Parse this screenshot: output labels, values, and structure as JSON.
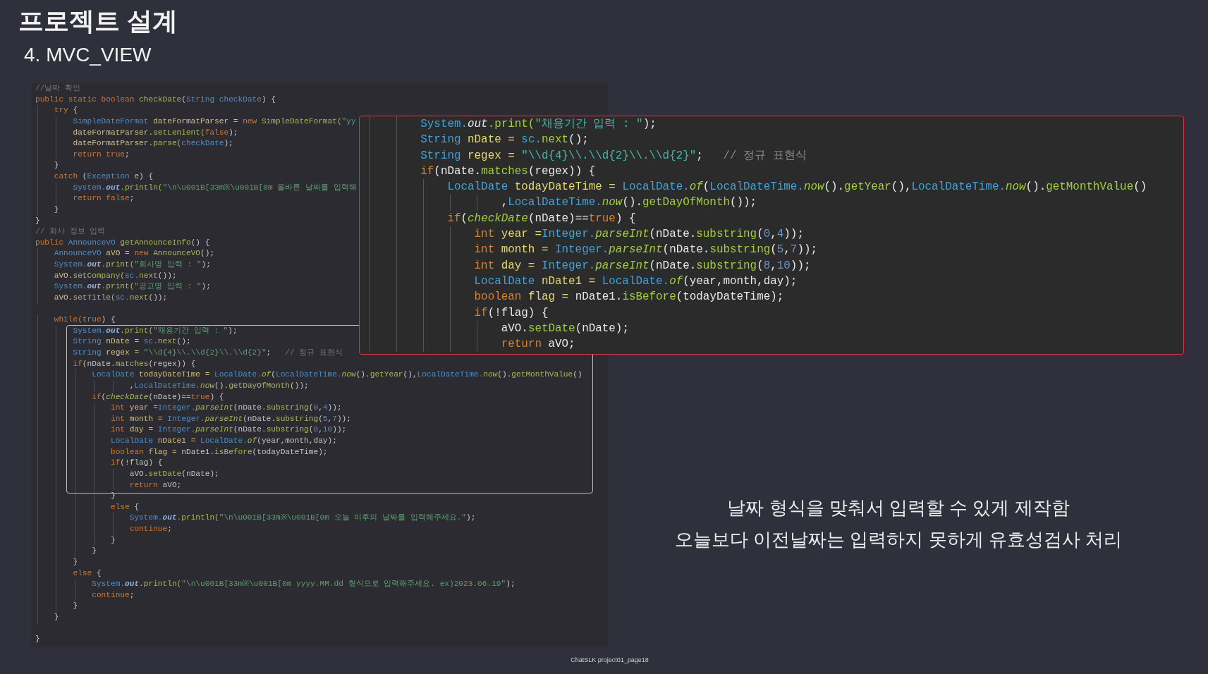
{
  "slide": {
    "title": "프로젝트 설계",
    "subtitle": "4. MVC_VIEW"
  },
  "code_panel": {
    "lines": [
      {
        "kind": "code",
        "tokens": [
          {
            "text": "//날짜 확인",
            "kind": "c"
          }
        ]
      },
      {
        "kind": "code",
        "tokens": [
          {
            "text": "public static boolean ",
            "kind": "k"
          },
          {
            "text": "checkDate",
            "kind": "m"
          },
          {
            "text": "(",
            "kind": "p"
          },
          {
            "text": "String ",
            "kind": "t"
          },
          {
            "text": "checkDate",
            "kind": "t"
          },
          {
            "text": ") {",
            "kind": "p"
          }
        ]
      },
      {
        "kind": "code",
        "tokens": [
          {
            "text": "    try ",
            "kind": "k"
          },
          {
            "text": "{",
            "kind": "p"
          }
        ]
      },
      {
        "kind": "code",
        "tokens": [
          {
            "text": "        SimpleDateFormat ",
            "kind": "t"
          },
          {
            "text": "dateFormatParser = ",
            "kind": "v"
          },
          {
            "text": "new ",
            "kind": "k"
          },
          {
            "text": "SimpleDateFormat(",
            "kind": "m"
          },
          {
            "text": "\"yy",
            "kind": "s"
          }
        ]
      },
      {
        "kind": "code",
        "tokens": [
          {
            "text": "        dateFormatParser.",
            "kind": "v"
          },
          {
            "text": "setLenient(",
            "kind": "m"
          },
          {
            "text": "false",
            "kind": "k"
          },
          {
            "text": ");",
            "kind": "p"
          }
        ]
      },
      {
        "kind": "code",
        "tokens": [
          {
            "text": "        dateFormatParser.",
            "kind": "v"
          },
          {
            "text": "parse(",
            "kind": "m"
          },
          {
            "text": "checkDate",
            "kind": "t"
          },
          {
            "text": ");",
            "kind": "p"
          }
        ]
      },
      {
        "kind": "code",
        "tokens": [
          {
            "text": "        return true",
            "kind": "k"
          },
          {
            "text": ";",
            "kind": "p"
          }
        ]
      },
      {
        "kind": "code",
        "tokens": [
          {
            "text": "    }",
            "kind": "p"
          }
        ]
      },
      {
        "kind": "code",
        "tokens": [
          {
            "text": "    catch ",
            "kind": "k"
          },
          {
            "text": "(",
            "kind": "p"
          },
          {
            "text": "Exception ",
            "kind": "t"
          },
          {
            "text": "e",
            "kind": "v"
          },
          {
            "text": ") {",
            "kind": "p"
          }
        ]
      },
      {
        "kind": "code",
        "tokens": [
          {
            "text": "        System.",
            "kind": "t"
          },
          {
            "text": "out",
            "kind": "f"
          },
          {
            "text": ".println(",
            "kind": "m"
          },
          {
            "text": "\"\\n\\u001B[33m※\\u001B[0m 올바른 날짜를 입력해",
            "kind": "s"
          }
        ]
      },
      {
        "kind": "code",
        "tokens": [
          {
            "text": "        return false",
            "kind": "k"
          },
          {
            "text": ";",
            "kind": "p"
          }
        ]
      },
      {
        "kind": "code",
        "tokens": [
          {
            "text": "    }",
            "kind": "p"
          }
        ]
      },
      {
        "kind": "code",
        "tokens": [
          {
            "text": "}",
            "kind": "p"
          }
        ]
      },
      {
        "kind": "code",
        "tokens": [
          {
            "text": "// 회사 정보 입력",
            "kind": "c"
          }
        ]
      },
      {
        "kind": "code",
        "tokens": [
          {
            "text": "public ",
            "kind": "k"
          },
          {
            "text": "AnnounceVO ",
            "kind": "t"
          },
          {
            "text": "getAnnounceInfo",
            "kind": "m"
          },
          {
            "text": "() {",
            "kind": "p"
          }
        ]
      },
      {
        "kind": "code",
        "tokens": [
          {
            "text": "    AnnounceVO ",
            "kind": "t"
          },
          {
            "text": "aVO = ",
            "kind": "v"
          },
          {
            "text": "new ",
            "kind": "k"
          },
          {
            "text": "AnnounceVO",
            "kind": "m"
          },
          {
            "text": "();",
            "kind": "p"
          }
        ]
      },
      {
        "kind": "code",
        "tokens": [
          {
            "text": "    System.",
            "kind": "t"
          },
          {
            "text": "out",
            "kind": "f"
          },
          {
            "text": ".print(",
            "kind": "m"
          },
          {
            "text": "\"회사명 입력 : \"",
            "kind": "s"
          },
          {
            "text": ");",
            "kind": "p"
          }
        ]
      },
      {
        "kind": "code",
        "tokens": [
          {
            "text": "    aVO.",
            "kind": "v"
          },
          {
            "text": "setCompany(",
            "kind": "m"
          },
          {
            "text": "sc.",
            "kind": "t"
          },
          {
            "text": "next",
            "kind": "m"
          },
          {
            "text": "());",
            "kind": "p"
          }
        ]
      },
      {
        "kind": "code",
        "tokens": [
          {
            "text": "    System.",
            "kind": "t"
          },
          {
            "text": "out",
            "kind": "f"
          },
          {
            "text": ".print(",
            "kind": "m"
          },
          {
            "text": "\"공고명 입력 : \"",
            "kind": "s"
          },
          {
            "text": ");",
            "kind": "p"
          }
        ]
      },
      {
        "kind": "code",
        "tokens": [
          {
            "text": "    aVO.",
            "kind": "v"
          },
          {
            "text": "setTitle(",
            "kind": "m"
          },
          {
            "text": "sc.",
            "kind": "t"
          },
          {
            "text": "next",
            "kind": "m"
          },
          {
            "text": "());",
            "kind": "p"
          }
        ]
      },
      {
        "kind": "blank"
      },
      {
        "kind": "code",
        "tokens": [
          {
            "text": "    while(true",
            "kind": "k"
          },
          {
            "text": ") {",
            "kind": "p"
          }
        ]
      },
      {
        "kind": "code",
        "tokens": [
          {
            "text": "        System.",
            "kind": "t"
          },
          {
            "text": "out",
            "kind": "f"
          },
          {
            "text": ".print(",
            "kind": "m"
          },
          {
            "text": "\"채용기간 입력 : \"",
            "kind": "s"
          },
          {
            "text": ");",
            "kind": "p"
          }
        ]
      },
      {
        "kind": "code",
        "tokens": [
          {
            "text": "        String ",
            "kind": "t"
          },
          {
            "text": "nDate = ",
            "kind": "v"
          },
          {
            "text": "sc.",
            "kind": "t"
          },
          {
            "text": "next",
            "kind": "m"
          },
          {
            "text": "();",
            "kind": "p"
          }
        ]
      },
      {
        "kind": "code",
        "tokens": [
          {
            "text": "        String ",
            "kind": "t"
          },
          {
            "text": "regex = ",
            "kind": "v"
          },
          {
            "text": "\"\\\\d{4}\\\\.\\\\d{2}\\\\.\\\\d{2}\"",
            "kind": "s"
          },
          {
            "text": ";",
            "kind": "p"
          },
          {
            "text": "   // 정규 표현식",
            "kind": "c"
          }
        ]
      },
      {
        "kind": "code",
        "tokens": [
          {
            "text": "        if",
            "kind": "k"
          },
          {
            "text": "(nDate.",
            "kind": "p"
          },
          {
            "text": "matches",
            "kind": "m"
          },
          {
            "text": "(regex)) {",
            "kind": "p"
          }
        ]
      },
      {
        "kind": "code",
        "tokens": [
          {
            "text": "            LocalDate ",
            "kind": "t"
          },
          {
            "text": "todayDateTime = ",
            "kind": "v"
          },
          {
            "text": "LocalDate.",
            "kind": "t"
          },
          {
            "text": "of",
            "kind": "mi"
          },
          {
            "text": "(",
            "kind": "p"
          },
          {
            "text": "LocalDateTime.",
            "kind": "t"
          },
          {
            "text": "now",
            "kind": "mi"
          },
          {
            "text": "().",
            "kind": "p"
          },
          {
            "text": "getYear",
            "kind": "m"
          },
          {
            "text": "(),",
            "kind": "p"
          },
          {
            "text": "LocalDateTime.",
            "kind": "t"
          },
          {
            "text": "now",
            "kind": "mi"
          },
          {
            "text": "().",
            "kind": "p"
          },
          {
            "text": "getMonthValue",
            "kind": "m"
          },
          {
            "text": "()",
            "kind": "p"
          }
        ]
      },
      {
        "kind": "code",
        "tokens": [
          {
            "text": "                    ,",
            "kind": "p"
          },
          {
            "text": "LocalDateTime.",
            "kind": "t"
          },
          {
            "text": "now",
            "kind": "mi"
          },
          {
            "text": "().",
            "kind": "p"
          },
          {
            "text": "getDayOfMonth",
            "kind": "m"
          },
          {
            "text": "());",
            "kind": "p"
          }
        ]
      },
      {
        "kind": "code",
        "tokens": [
          {
            "text": "            if",
            "kind": "k"
          },
          {
            "text": "(",
            "kind": "p"
          },
          {
            "text": "checkDate",
            "kind": "mi"
          },
          {
            "text": "(nDate)==",
            "kind": "p"
          },
          {
            "text": "true",
            "kind": "k"
          },
          {
            "text": ") {",
            "kind": "p"
          }
        ]
      },
      {
        "kind": "code",
        "tokens": [
          {
            "text": "                int ",
            "kind": "k"
          },
          {
            "text": "year =",
            "kind": "v"
          },
          {
            "text": "Integer.",
            "kind": "t"
          },
          {
            "text": "parseInt",
            "kind": "mi"
          },
          {
            "text": "(nDate.",
            "kind": "p"
          },
          {
            "text": "substring",
            "kind": "m"
          },
          {
            "text": "(",
            "kind": "p"
          },
          {
            "text": "0",
            "kind": "n"
          },
          {
            "text": ",",
            "kind": "p"
          },
          {
            "text": "4",
            "kind": "n"
          },
          {
            "text": "));",
            "kind": "p"
          }
        ]
      },
      {
        "kind": "code",
        "tokens": [
          {
            "text": "                int ",
            "kind": "k"
          },
          {
            "text": "month = ",
            "kind": "v"
          },
          {
            "text": "Integer.",
            "kind": "t"
          },
          {
            "text": "parseInt",
            "kind": "mi"
          },
          {
            "text": "(nDate.",
            "kind": "p"
          },
          {
            "text": "substring",
            "kind": "m"
          },
          {
            "text": "(",
            "kind": "p"
          },
          {
            "text": "5",
            "kind": "n"
          },
          {
            "text": ",",
            "kind": "p"
          },
          {
            "text": "7",
            "kind": "n"
          },
          {
            "text": "));",
            "kind": "p"
          }
        ]
      },
      {
        "kind": "code",
        "tokens": [
          {
            "text": "                int ",
            "kind": "k"
          },
          {
            "text": "day = ",
            "kind": "v"
          },
          {
            "text": "Integer.",
            "kind": "t"
          },
          {
            "text": "parseInt",
            "kind": "mi"
          },
          {
            "text": "(nDate.",
            "kind": "p"
          },
          {
            "text": "substring",
            "kind": "m"
          },
          {
            "text": "(",
            "kind": "p"
          },
          {
            "text": "8",
            "kind": "n"
          },
          {
            "text": ",",
            "kind": "p"
          },
          {
            "text": "10",
            "kind": "n"
          },
          {
            "text": "));",
            "kind": "p"
          }
        ]
      },
      {
        "kind": "code",
        "tokens": [
          {
            "text": "                LocalDate ",
            "kind": "t"
          },
          {
            "text": "nDate1 = ",
            "kind": "v"
          },
          {
            "text": "LocalDate.",
            "kind": "t"
          },
          {
            "text": "of",
            "kind": "mi"
          },
          {
            "text": "(year,month,day);",
            "kind": "p"
          }
        ]
      },
      {
        "kind": "code",
        "tokens": [
          {
            "text": "                boolean ",
            "kind": "k"
          },
          {
            "text": "flag = ",
            "kind": "v"
          },
          {
            "text": "nDate1.",
            "kind": "p"
          },
          {
            "text": "isBefore",
            "kind": "m"
          },
          {
            "text": "(todayDateTime);",
            "kind": "p"
          }
        ]
      },
      {
        "kind": "code",
        "tokens": [
          {
            "text": "                if",
            "kind": "k"
          },
          {
            "text": "(!flag) {",
            "kind": "p"
          }
        ]
      },
      {
        "kind": "code",
        "tokens": [
          {
            "text": "                    aVO.",
            "kind": "p"
          },
          {
            "text": "setDate",
            "kind": "m"
          },
          {
            "text": "(nDate);",
            "kind": "p"
          }
        ]
      },
      {
        "kind": "code",
        "tokens": [
          {
            "text": "                    return ",
            "kind": "k"
          },
          {
            "text": "aVO;",
            "kind": "p"
          }
        ]
      },
      {
        "kind": "code",
        "tokens": [
          {
            "text": "                }",
            "kind": "p"
          }
        ]
      },
      {
        "kind": "code",
        "tokens": [
          {
            "text": "                else ",
            "kind": "k"
          },
          {
            "text": "{",
            "kind": "p"
          }
        ]
      },
      {
        "kind": "code",
        "tokens": [
          {
            "text": "                    System.",
            "kind": "t"
          },
          {
            "text": "out",
            "kind": "f"
          },
          {
            "text": ".println(",
            "kind": "m"
          },
          {
            "text": "\"\\n\\u001B[33m※\\u001B[0m 오늘 이후의 날짜를 입력해주세요.\"",
            "kind": "s"
          },
          {
            "text": ");",
            "kind": "p"
          }
        ]
      },
      {
        "kind": "code",
        "tokens": [
          {
            "text": "                    continue",
            "kind": "k"
          },
          {
            "text": ";",
            "kind": "p"
          }
        ]
      },
      {
        "kind": "code",
        "tokens": [
          {
            "text": "                }",
            "kind": "p"
          }
        ]
      },
      {
        "kind": "code",
        "tokens": [
          {
            "text": "            }",
            "kind": "p"
          }
        ]
      },
      {
        "kind": "code",
        "tokens": [
          {
            "text": "        }",
            "kind": "p"
          }
        ]
      },
      {
        "kind": "code",
        "tokens": [
          {
            "text": "        else ",
            "kind": "k"
          },
          {
            "text": "{",
            "kind": "p"
          }
        ]
      },
      {
        "kind": "code",
        "tokens": [
          {
            "text": "            System.",
            "kind": "t"
          },
          {
            "text": "out",
            "kind": "f"
          },
          {
            "text": ".println(",
            "kind": "m"
          },
          {
            "text": "\"\\n\\u001B[33m※\\u001B[0m yyyy.MM.dd 형식으로 입력해주세요. ex)2023.06.19\"",
            "kind": "s"
          },
          {
            "text": ");",
            "kind": "p"
          }
        ]
      },
      {
        "kind": "code",
        "tokens": [
          {
            "text": "            continue",
            "kind": "k"
          },
          {
            "text": ";",
            "kind": "p"
          }
        ]
      },
      {
        "kind": "code",
        "tokens": [
          {
            "text": "        }",
            "kind": "p"
          }
        ]
      },
      {
        "kind": "code",
        "tokens": [
          {
            "text": "    }",
            "kind": "p"
          }
        ]
      },
      {
        "kind": "blank"
      },
      {
        "kind": "code",
        "tokens": [
          {
            "text": "}",
            "kind": "p"
          }
        ]
      }
    ]
  },
  "zoomed_code": {
    "lines": [
      {
        "kind": "code",
        "tokens": [
          {
            "text": "        System.",
            "kind": "t"
          },
          {
            "text": "out",
            "kind": "f"
          },
          {
            "text": ".print(",
            "kind": "m"
          },
          {
            "text": "\"채용기간 입력 : \"",
            "kind": "s"
          },
          {
            "text": ");",
            "kind": "p"
          }
        ]
      },
      {
        "kind": "code",
        "tokens": [
          {
            "text": "        String ",
            "kind": "t"
          },
          {
            "text": "nDate = ",
            "kind": "v"
          },
          {
            "text": "sc.",
            "kind": "t"
          },
          {
            "text": "next",
            "kind": "m"
          },
          {
            "text": "();",
            "kind": "p"
          }
        ]
      },
      {
        "kind": "code",
        "tokens": [
          {
            "text": "        String ",
            "kind": "t"
          },
          {
            "text": "regex = ",
            "kind": "v"
          },
          {
            "text": "\"\\\\d{4}\\\\.\\\\d{2}\\\\.\\\\d{2}\"",
            "kind": "s"
          },
          {
            "text": ";",
            "kind": "p"
          },
          {
            "text": "   // 정규 표현식",
            "kind": "c"
          }
        ]
      },
      {
        "kind": "code",
        "tokens": [
          {
            "text": "        if",
            "kind": "k"
          },
          {
            "text": "(nDate.",
            "kind": "p"
          },
          {
            "text": "matches",
            "kind": "m"
          },
          {
            "text": "(regex)) {",
            "kind": "p"
          }
        ]
      },
      {
        "kind": "code",
        "tokens": [
          {
            "text": "            LocalDate ",
            "kind": "t"
          },
          {
            "text": "todayDateTime = ",
            "kind": "v"
          },
          {
            "text": "LocalDate.",
            "kind": "t"
          },
          {
            "text": "of",
            "kind": "mi"
          },
          {
            "text": "(",
            "kind": "p"
          },
          {
            "text": "LocalDateTime.",
            "kind": "t"
          },
          {
            "text": "now",
            "kind": "mi"
          },
          {
            "text": "().",
            "kind": "p"
          },
          {
            "text": "getYear",
            "kind": "m"
          },
          {
            "text": "(),",
            "kind": "p"
          },
          {
            "text": "LocalDateTime.",
            "kind": "t"
          },
          {
            "text": "now",
            "kind": "mi"
          },
          {
            "text": "().",
            "kind": "p"
          },
          {
            "text": "getMonthValue",
            "kind": "m"
          },
          {
            "text": "()",
            "kind": "p"
          }
        ]
      },
      {
        "kind": "code",
        "tokens": [
          {
            "text": "                    ,",
            "kind": "p"
          },
          {
            "text": "LocalDateTime.",
            "kind": "t"
          },
          {
            "text": "now",
            "kind": "mi"
          },
          {
            "text": "().",
            "kind": "p"
          },
          {
            "text": "getDayOfMonth",
            "kind": "m"
          },
          {
            "text": "());",
            "kind": "p"
          }
        ]
      },
      {
        "kind": "code",
        "tokens": [
          {
            "text": "            if",
            "kind": "k"
          },
          {
            "text": "(",
            "kind": "p"
          },
          {
            "text": "checkDate",
            "kind": "mi"
          },
          {
            "text": "(nDate)==",
            "kind": "p"
          },
          {
            "text": "true",
            "kind": "k"
          },
          {
            "text": ") {",
            "kind": "p"
          }
        ]
      },
      {
        "kind": "code",
        "tokens": [
          {
            "text": "                int ",
            "kind": "k"
          },
          {
            "text": "year =",
            "kind": "v"
          },
          {
            "text": "Integer.",
            "kind": "t"
          },
          {
            "text": "parseInt",
            "kind": "mi"
          },
          {
            "text": "(nDate.",
            "kind": "p"
          },
          {
            "text": "substring",
            "kind": "m"
          },
          {
            "text": "(",
            "kind": "p"
          },
          {
            "text": "0",
            "kind": "n"
          },
          {
            "text": ",",
            "kind": "p"
          },
          {
            "text": "4",
            "kind": "n"
          },
          {
            "text": "));",
            "kind": "p"
          }
        ]
      },
      {
        "kind": "code",
        "tokens": [
          {
            "text": "                int ",
            "kind": "k"
          },
          {
            "text": "month = ",
            "kind": "v"
          },
          {
            "text": "Integer.",
            "kind": "t"
          },
          {
            "text": "parseInt",
            "kind": "mi"
          },
          {
            "text": "(nDate.",
            "kind": "p"
          },
          {
            "text": "substring",
            "kind": "m"
          },
          {
            "text": "(",
            "kind": "p"
          },
          {
            "text": "5",
            "kind": "n"
          },
          {
            "text": ",",
            "kind": "p"
          },
          {
            "text": "7",
            "kind": "n"
          },
          {
            "text": "));",
            "kind": "p"
          }
        ]
      },
      {
        "kind": "code",
        "tokens": [
          {
            "text": "                int ",
            "kind": "k"
          },
          {
            "text": "day = ",
            "kind": "v"
          },
          {
            "text": "Integer.",
            "kind": "t"
          },
          {
            "text": "parseInt",
            "kind": "mi"
          },
          {
            "text": "(nDate.",
            "kind": "p"
          },
          {
            "text": "substring",
            "kind": "m"
          },
          {
            "text": "(",
            "kind": "p"
          },
          {
            "text": "8",
            "kind": "n"
          },
          {
            "text": ",",
            "kind": "p"
          },
          {
            "text": "10",
            "kind": "n"
          },
          {
            "text": "));",
            "kind": "p"
          }
        ]
      },
      {
        "kind": "code",
        "tokens": [
          {
            "text": "                LocalDate ",
            "kind": "t"
          },
          {
            "text": "nDate1 = ",
            "kind": "v"
          },
          {
            "text": "LocalDate.",
            "kind": "t"
          },
          {
            "text": "of",
            "kind": "mi"
          },
          {
            "text": "(year,month,day);",
            "kind": "p"
          }
        ]
      },
      {
        "kind": "code",
        "tokens": [
          {
            "text": "                boolean ",
            "kind": "k"
          },
          {
            "text": "flag = ",
            "kind": "v"
          },
          {
            "text": "nDate1.",
            "kind": "p"
          },
          {
            "text": "isBefore",
            "kind": "m"
          },
          {
            "text": "(todayDateTime);",
            "kind": "p"
          }
        ]
      },
      {
        "kind": "code",
        "tokens": [
          {
            "text": "                if",
            "kind": "k"
          },
          {
            "text": "(!flag) {",
            "kind": "p"
          }
        ]
      },
      {
        "kind": "code",
        "tokens": [
          {
            "text": "                    aVO.",
            "kind": "p"
          },
          {
            "text": "setDate",
            "kind": "m"
          },
          {
            "text": "(nDate);",
            "kind": "p"
          }
        ]
      },
      {
        "kind": "code",
        "tokens": [
          {
            "text": "                    return ",
            "kind": "k"
          },
          {
            "text": "aVO;",
            "kind": "p"
          }
        ]
      }
    ]
  },
  "description": [
    "날짜 형식을 맞춰서 입력할 수 있게 제작함",
    "오늘보다 이전날짜는 입력하지 못하게 유효성검사 처리"
  ],
  "footer": "ChatSLK project01_page18"
}
